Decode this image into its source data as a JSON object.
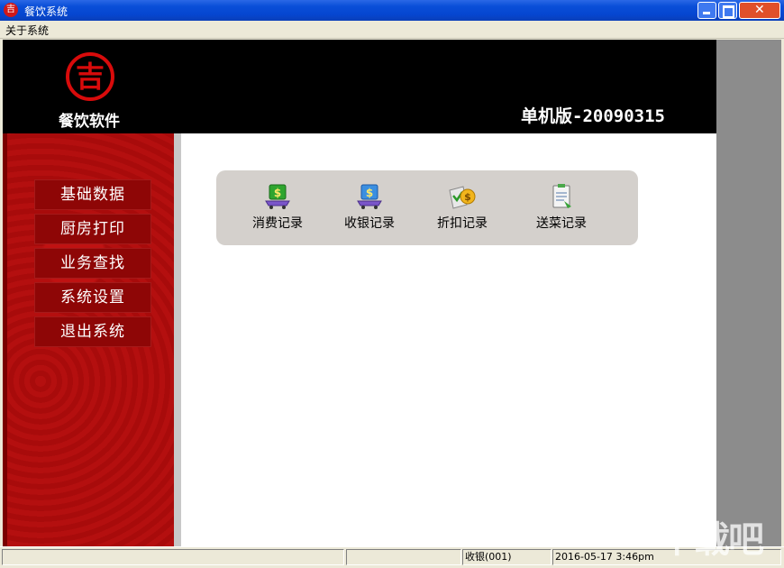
{
  "window": {
    "title": "餐饮系统",
    "app_icon_glyph": "吉",
    "controls": [
      "minimize-icon",
      "maximize-icon",
      "close-icon"
    ]
  },
  "menubar": {
    "items": [
      {
        "label": "关于系统"
      }
    ]
  },
  "header": {
    "logo_glyph": "吉",
    "brand_name": "餐饮软件",
    "version": "单机版-20090315",
    "logo_color": "#d80b0b"
  },
  "sidebar": {
    "background_color": "#b40f0f",
    "items": [
      {
        "label": "基础数据"
      },
      {
        "label": "厨房打印"
      },
      {
        "label": "业务查找"
      },
      {
        "label": "系统设置"
      },
      {
        "label": "退出系统"
      }
    ]
  },
  "toolbar": {
    "items": [
      {
        "label": "消费记录",
        "icon": "green-money-cart-icon"
      },
      {
        "label": "收银记录",
        "icon": "blue-money-cart-icon"
      },
      {
        "label": "折扣记录",
        "icon": "discount-coin-icon"
      },
      {
        "label": "送菜记录",
        "icon": "delivery-clipboard-icon"
      }
    ]
  },
  "statusbar": {
    "cells": [
      "",
      "",
      "收银(001)",
      "2016-05-17 3:46pm"
    ]
  },
  "watermark": {
    "text": "下载吧"
  }
}
